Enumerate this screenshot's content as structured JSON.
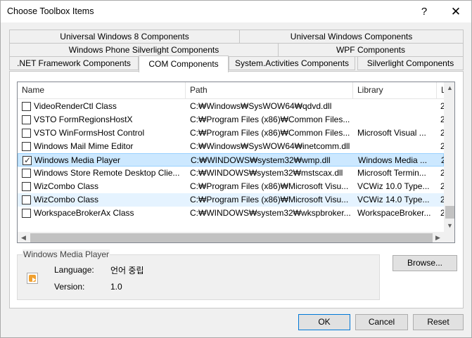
{
  "window": {
    "title": "Choose Toolbox Items",
    "help_label": "?",
    "close_label": "✕"
  },
  "tabs": {
    "row1": [
      "Universal Windows 8 Components",
      "Universal Windows Components"
    ],
    "row2": [
      "Windows Phone Silverlight Components",
      "WPF Components"
    ],
    "row3": [
      ".NET Framework Components",
      "COM Components",
      "System.Activities Components",
      "Silverlight Components"
    ],
    "active": "COM Components"
  },
  "list": {
    "columns": [
      "Name",
      "Path",
      "Library",
      "L"
    ],
    "rows": [
      {
        "checked": false,
        "name": "VideoRenderCtl Class",
        "path": "C:₩Windows₩SysWOW64₩qdvd.dll",
        "library": "",
        "version": "2"
      },
      {
        "checked": false,
        "name": "VSTO FormRegionsHostX",
        "path": "C:₩Program Files (x86)₩Common Files...",
        "library": "",
        "version": "2"
      },
      {
        "checked": false,
        "name": "VSTO WinFormsHost Control",
        "path": "C:₩Program Files (x86)₩Common Files...",
        "library": "Microsoft Visual ...",
        "version": "2"
      },
      {
        "checked": false,
        "name": "Windows Mail Mime Editor",
        "path": "C:₩Windows₩SysWOW64₩inetcomm.dll",
        "library": "",
        "version": "2"
      },
      {
        "checked": true,
        "name": "Windows Media Player",
        "path": "C:₩WINDOWS₩system32₩wmp.dll",
        "library": "Windows Media ...",
        "version": "2"
      },
      {
        "checked": false,
        "name": "Windows Store Remote Desktop Clie...",
        "path": "C:₩WINDOWS₩system32₩mstscax.dll",
        "library": "Microsoft Termin...",
        "version": "2"
      },
      {
        "checked": false,
        "name": "WizCombo Class",
        "path": "C:₩Program Files (x86)₩Microsoft Visu...",
        "library": "VCWiz 10.0 Type...",
        "version": "2"
      },
      {
        "checked": false,
        "name": "WizCombo Class",
        "path": "C:₩Program Files (x86)₩Microsoft Visu...",
        "library": "VCWiz 14.0 Type...",
        "version": "2"
      },
      {
        "checked": false,
        "name": "WorkspaceBrokerAx Class",
        "path": "C:₩WINDOWS₩system32₩wkspbroker...",
        "library": "WorkspaceBroker...",
        "version": "2"
      }
    ],
    "selected_index": 4,
    "hover_index": 7
  },
  "details": {
    "group_title": "Windows Media Player",
    "icon": "media-player-icon",
    "language_label": "Language:",
    "language_value": "언어 중립",
    "version_label": "Version:",
    "version_value": "1.0",
    "browse_label": "Browse..."
  },
  "buttons": {
    "ok": "OK",
    "cancel": "Cancel",
    "reset": "Reset"
  },
  "colors": {
    "selection_bg": "#cce8ff",
    "hover_bg": "#e5f3ff",
    "accent": "#0078d7"
  }
}
